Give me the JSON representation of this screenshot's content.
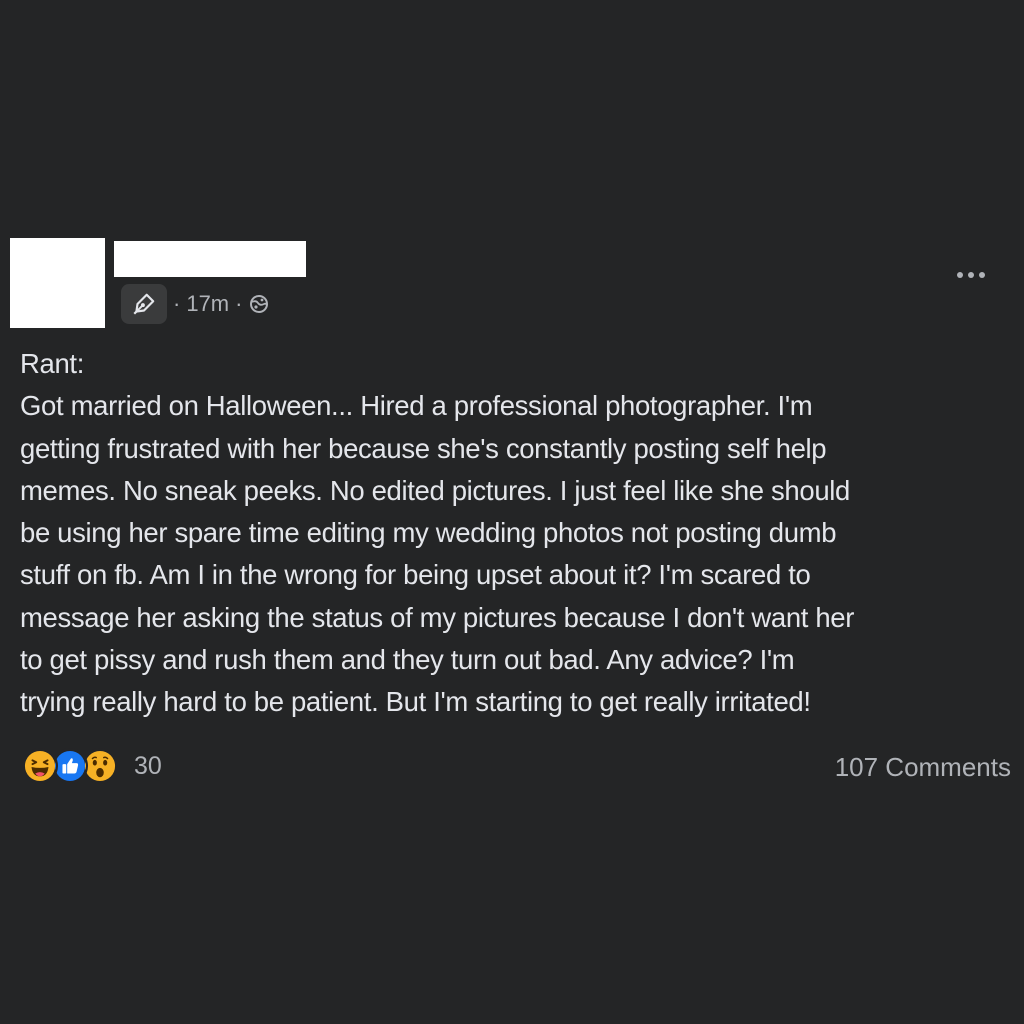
{
  "post": {
    "timestamp": "17m",
    "separator": "·",
    "icons": {
      "author_badge": "pen-nib-icon",
      "audience": "globe-icon",
      "more": "more-options-icon"
    },
    "text_lines": [
      "Rant:",
      "Got married on Halloween... Hired a professional photographer. I'm",
      "getting frustrated with her because she's constantly posting self help",
      "memes. No sneak peeks. No edited pictures. I just feel like she should",
      "be using her spare time editing my wedding photos not posting dumb",
      "stuff on fb. Am I in the wrong for being upset about it? I'm scared to",
      "message her asking the status of my pictures because I don't want her",
      "to get pissy and rush them and they turn out bad. Any advice? I'm",
      "trying really hard to be patient. But I'm starting to get really irritated!"
    ]
  },
  "footer": {
    "reactions": [
      "haha",
      "like",
      "wow"
    ],
    "reaction_count": "30",
    "comments_label": "107 Comments"
  },
  "colors": {
    "background": "#242526",
    "text": "#e4e6eb",
    "secondary_text": "#b0b3b8",
    "like_blue": "#1877f2",
    "emoji_yellow": "#f7b125"
  }
}
